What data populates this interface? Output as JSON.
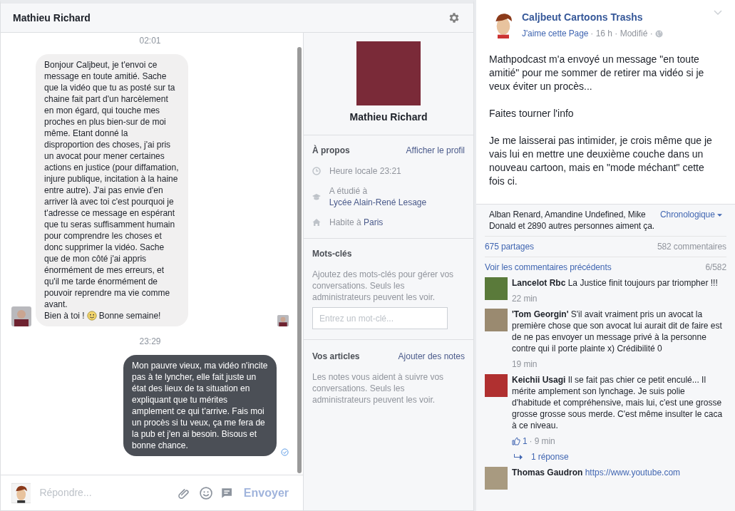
{
  "chat": {
    "title": "Mathieu Richard",
    "messages": [
      {
        "kind": "time",
        "text": "02:01"
      },
      {
        "kind": "incoming",
        "text": "Bonjour Caljbeut, je t'envoi ce message en toute amitié. Sache que la vidéo que tu as posté sur ta chaine fait part d'un harcèlement en mon égard, qui touche mes proches en plus bien-sur de moi même. Etant donné la disproportion des choses, j'ai pris un avocat pour mener certaines actions en justice (pour diffamation, injure publique, incitation à la haine entre autre). J'ai pas envie d'en arriver là avec toi c'est pourquoi je t'adresse ce message en espérant que tu seras suffisamment humain pour comprendre les choses et donc supprimer la vidéo. Sache que de mon côté j'ai appris énormément de mes erreurs, et qu'il me tarde énormément de pouvoir reprendre ma vie comme avant.",
        "text_before": "Bien à toi !",
        "text_after": "Bonne semaine!",
        "seen": true
      },
      {
        "kind": "time",
        "text": "23:29"
      },
      {
        "kind": "outgoing",
        "text": "Mon pauvre vieux, ma vidéo n'incite pas à te lyncher, elle fait juste un état des lieux de ta situation en expliquant que tu mérites amplement ce qui t'arrive. Fais moi un procès si tu veux, ça me fera de la pub et j'en ai besoin. Bisous et bonne chance.",
        "delivered": true
      }
    ],
    "compose": {
      "placeholder": "Répondre...",
      "send": "Envoyer"
    }
  },
  "profile": {
    "name": "Mathieu Richard",
    "about": {
      "heading": "À propos",
      "link": "Afficher le profil",
      "items": [
        {
          "kind": "clock",
          "text": "Heure locale 23:21"
        },
        {
          "kind": "school",
          "text": "A étudié à",
          "link": "Lycée Alain-René Lesage"
        },
        {
          "kind": "home",
          "text": "Habite à",
          "link": "Paris"
        }
      ]
    },
    "keywords": {
      "heading": "Mots-clés",
      "description": "Ajoutez des mots-clés pour gérer vos conversations. Seuls les administrateurs peuvent les voir.",
      "placeholder": "Entrez un mot-clé..."
    },
    "notes": {
      "heading": "Vos articles",
      "link": "Ajouter des notes",
      "description": "Les notes vous aident à suivre vos conversations. Seuls les administrateurs peuvent les voir."
    }
  },
  "post": {
    "page": "Caljbeut Cartoons Trashs",
    "like_link": "J'aime cette Page",
    "meta": "· 16 h · Modifié ·",
    "paragraphs": [
      "Mathpodcast m'a envoyé un message \"en toute amitié\" pour me sommer de retirer ma vidéo si je veux éviter un procès...",
      "Faites tourner l'info",
      "Je me laisserai pas intimider, je crois même que je vais lui en mettre une deuxième couche dans un nouveau cartoon, mais en \"mode méchant\" cette fois ci."
    ],
    "likes": "Alban Renard, Amandine Undefined, Mike Donald et 2890 autres personnes aiment ça.",
    "order": "Chronologique",
    "shares": "675 partages",
    "comment_count": "582 commentaires",
    "previous": "Voir les commentaires précédents",
    "shown": "6/582",
    "comments": [
      {
        "text": "**Lancelot Rbc** La Justice finit toujours par triompher !!!",
        "time": "22 min",
        "color": "#5a7a3a"
      },
      {
        "text": "**'Tom Georgin'** S'il avait vraiment pris un avocat la première chose que son avocat lui aurait dit de faire est de ne pas envoyer un message privé à la personne contre qui il porte plainte x) Crédibilité 0",
        "time": "19 min",
        "color": "#9a8a70"
      },
      {
        "text": "**Keichii Usagi** Il se fait pas chier ce petit enculé... Il mérite amplement son lynchage. Je suis polie d'habitude et compréhensive, mais lui, c'est une grosse grosse grosse sous merde. C'est même insulter le caca à ce niveau.",
        "likes": "1",
        "time": "· 9 min",
        "replies": "1 réponse",
        "color": "#b03030"
      },
      {
        "text": "**Thomas Gaudron**",
        "link": "https://www.youtube.com",
        "color": "#a89a80"
      }
    ]
  }
}
